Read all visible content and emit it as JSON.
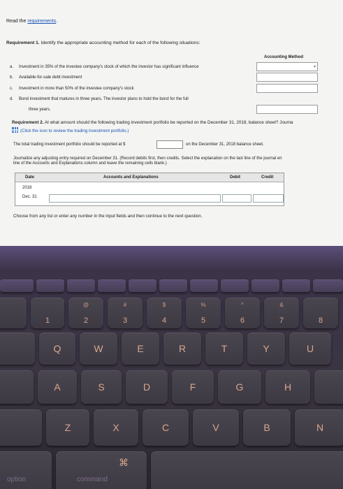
{
  "header": {
    "read_prefix": "Read the ",
    "read_link": "requirements",
    "read_suffix": "."
  },
  "requirement1": {
    "label": "Requirement 1.",
    "text": " Identify the appropriate accounting method for each of the following situations:",
    "column_header": "Accounting Method",
    "situations": [
      {
        "letter": "a.",
        "text": "Investment in 35% of the investee company's stock of which the investor has significant influence",
        "value": ""
      },
      {
        "letter": "b.",
        "text": "Available-for-sale debt investment",
        "value": ""
      },
      {
        "letter": "c.",
        "text": "Investment in more than 50% of the investee company's stock",
        "value": ""
      },
      {
        "letter": "d.",
        "text": "Bond investment that matures in three years. The investor plans to hold the bond for the full",
        "text2": "three years.",
        "value": ""
      }
    ]
  },
  "requirement2": {
    "label": "Requirement 2.",
    "text": " At what amount should the following trading investment portfolio be reported on the December 31, 2018, balance sheet? Journa",
    "click_text": "(Click the icon to review the trading investment portfolio.)",
    "portfolio_prefix": "The total trading investment portfolio should be reported at $",
    "portfolio_value": "",
    "portfolio_suffix": "on the December 31, 2018 balance sheet.",
    "journalize_line1": "Journalize any adjusting entry required on December 31. (Record debits first, then credits. Select the explanation on the last line of the journal en",
    "journalize_line2": "line of the Accounts and Explanations column and leave the remaining cells blank.)"
  },
  "journal": {
    "headers": {
      "date": "Date",
      "accounts": "Accounts and Explanations",
      "debit": "Debit",
      "credit": "Credit"
    },
    "year": "2018",
    "day": "Dec. 31"
  },
  "footer": {
    "instruction": "Choose from any list or enter any number in the input fields and then continue to the next question."
  },
  "keyboard": {
    "number_row": [
      {
        "top": "",
        "bottom": "1"
      },
      {
        "top": "@",
        "bottom": "2"
      },
      {
        "top": "#",
        "bottom": "3"
      },
      {
        "top": "$",
        "bottom": "4"
      },
      {
        "top": "%",
        "bottom": "5"
      },
      {
        "top": "^",
        "bottom": "6"
      },
      {
        "top": "&",
        "bottom": "7"
      },
      {
        "top": "",
        "bottom": "8"
      }
    ],
    "row_q": [
      "Q",
      "W",
      "E",
      "R",
      "T",
      "Y",
      "U"
    ],
    "row_a": [
      "A",
      "S",
      "D",
      "F",
      "G",
      "H"
    ],
    "row_z": [
      "Z",
      "X",
      "C",
      "V",
      "B",
      "N"
    ],
    "command_symbol": "⌘",
    "option_label": "option",
    "command_label": "command"
  },
  "colors": {
    "link": "#1a55b5",
    "key_legend": "#d7a78d",
    "bezel": "#3b3542"
  }
}
